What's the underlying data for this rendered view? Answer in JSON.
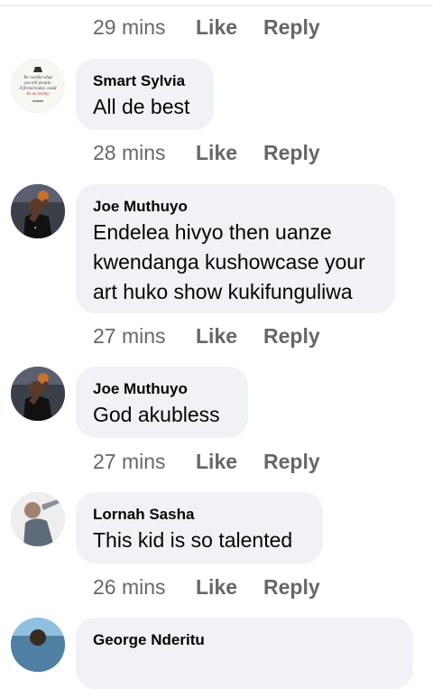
{
  "actions": {
    "like": "Like",
    "reply": "Reply"
  },
  "comments": [
    {
      "name": "",
      "text": "",
      "time": "29 mins"
    },
    {
      "name": "Smart Sylvia",
      "text": "All de best",
      "time": "28 mins",
      "avatar_text": [
        "Be careful what",
        "you tell people.",
        "A friend today could",
        "be an enemy"
      ]
    },
    {
      "name": "Joe Muthuyo",
      "text_lines": [
        "Endelea hivyo then uanze",
        "kwendanga kushowcase your",
        "art huko show kukifunguliwa"
      ],
      "time": "27 mins"
    },
    {
      "name": "Joe Muthuyo",
      "text": "God akubless",
      "time": "27 mins"
    },
    {
      "name": "Lornah Sasha",
      "text": "This kid is so talented",
      "time": "26 mins"
    },
    {
      "name": "George Nderitu",
      "text": ""
    }
  ],
  "colors": {
    "bubble": "#f0f2f5",
    "meta": "#65676b",
    "text": "#050505"
  }
}
